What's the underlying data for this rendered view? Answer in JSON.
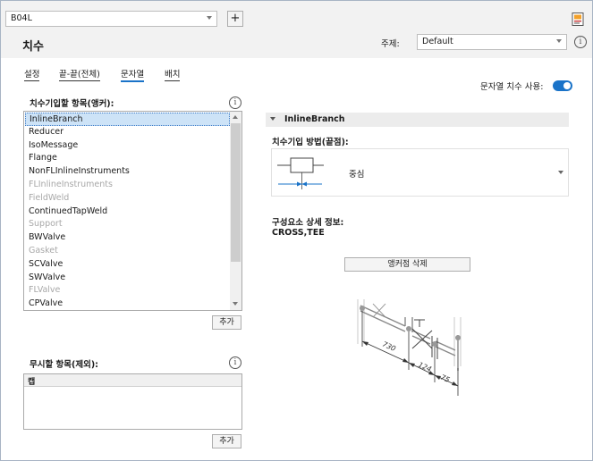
{
  "top": {
    "file_value": "B04L",
    "add_label": "+",
    "title": "치수",
    "theme_label": "주제:",
    "theme_value": "Default"
  },
  "tabs": [
    {
      "label": "설정"
    },
    {
      "label": "끝-끝(전체)"
    },
    {
      "label": "문자열"
    },
    {
      "label": "배치"
    }
  ],
  "toggle": {
    "label": "문자열 치수 사용:",
    "on": true
  },
  "left": {
    "dimension_label": "치수기입할 항목(앵커):",
    "items": [
      {
        "text": "InlineBranch",
        "state": "selected"
      },
      {
        "text": "Reducer",
        "state": "normal"
      },
      {
        "text": "IsoMessage",
        "state": "normal"
      },
      {
        "text": "Flange",
        "state": "normal"
      },
      {
        "text": "NonFLInlineInstruments",
        "state": "normal"
      },
      {
        "text": "FLInlineInstruments",
        "state": "disabled"
      },
      {
        "text": "FieldWeld",
        "state": "disabled"
      },
      {
        "text": "ContinuedTapWeld",
        "state": "normal"
      },
      {
        "text": "Support",
        "state": "disabled"
      },
      {
        "text": "BWValve",
        "state": "normal"
      },
      {
        "text": "Gasket",
        "state": "disabled"
      },
      {
        "text": "SCValve",
        "state": "normal"
      },
      {
        "text": "SWValve",
        "state": "normal"
      },
      {
        "text": "FLValve",
        "state": "disabled"
      },
      {
        "text": "CPValve",
        "state": "normal"
      }
    ],
    "add_button_1": "추가",
    "ignore_label": "무시할 항목(제외):",
    "ignore_header": "캡",
    "add_button_2": "추가"
  },
  "right": {
    "section_title": "InlineBranch",
    "method_label": "치수기입 방법(끝점):",
    "method_value": "중심",
    "component_label": "구성요소 상세 정보:",
    "component_value": "CROSS,TEE",
    "delete_anchor_button": "앵커점 삭제",
    "illustration": {
      "dim_1": "730",
      "dim_2": "124",
      "dim_3": "75"
    }
  },
  "colors": {
    "accent": "#1a73c8",
    "selection": "#cde3f7",
    "disabled_text": "#a8a8a8"
  }
}
